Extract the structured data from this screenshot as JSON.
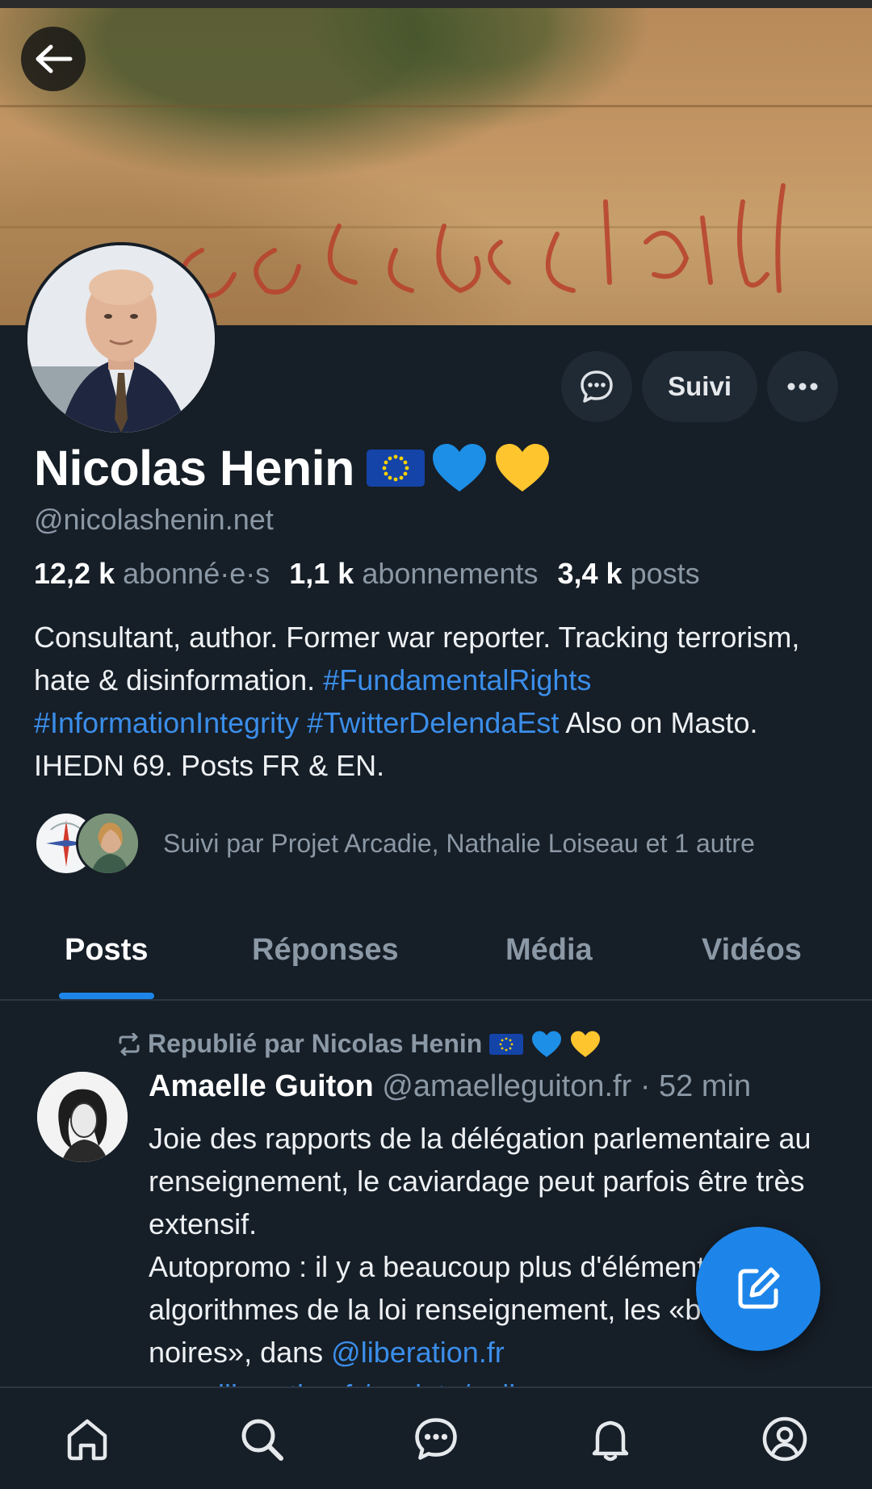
{
  "profile": {
    "display_name": "Nicolas Henin",
    "handle": "@nicolashenin.net",
    "name_emojis": [
      "eu-flag",
      "blue-heart",
      "yellow-heart"
    ],
    "stats": {
      "followers_count": "12,2 k",
      "followers_label": "abonné·e·s",
      "following_count": "1,1 k",
      "following_label": "abonnements",
      "posts_count": "3,4 k",
      "posts_label": "posts"
    },
    "bio": {
      "part1": "Consultant, author. Former war reporter. Tracking terrorism, hate & disinformation. ",
      "tag1": "#FundamentalRights",
      "tag2": "#InformationIntegrity",
      "tag3": "#TwitterDelendaEst",
      "part2": " Also on Masto. IHEDN 69. Posts FR & EN."
    },
    "followed_by": "Suivi par Projet Arcadie, Nathalie Loiseau et 1 autre"
  },
  "actions": {
    "follow_label": "Suivi"
  },
  "tabs": [
    "Posts",
    "Réponses",
    "Média",
    "Vidéos"
  ],
  "active_tab": "Posts",
  "feed": {
    "repost_label": "Republié par Nicolas Henin",
    "post": {
      "author": "Amaelle Guiton",
      "handle": "@amaelleguiton.fr",
      "time": "· 52 min",
      "text_line1": "Joie des rapports de la délégation parlementaire au renseignement, le caviardage peut parfois être très extensif.",
      "text_line2": "Autopromo : il y a beaucoup plus d'éléments sur les algorithmes de la loi renseignement, les «boîtes noires», dans ",
      "mention": "@liberation.fr",
      "link": "www.liberation.fr/societe/poli..."
    }
  },
  "icons": {
    "back": "arrow-left-icon",
    "message": "chat-bubble-icon",
    "more": "ellipsis-icon",
    "repost": "repost-icon",
    "compose": "compose-icon",
    "nav": [
      "home-icon",
      "search-icon",
      "chat-icon",
      "bell-icon",
      "profile-icon"
    ]
  },
  "colors": {
    "background": "#161e27",
    "accent": "#1d85e9",
    "link": "#3b8eea",
    "muted": "#8b98a5"
  }
}
